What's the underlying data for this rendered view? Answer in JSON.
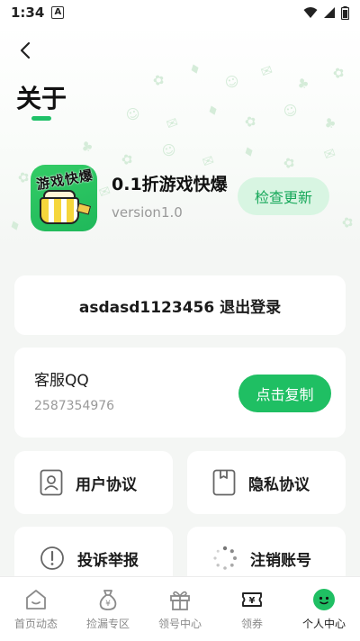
{
  "status_bar": {
    "time": "1:34",
    "notification_letter": "A"
  },
  "header": {
    "title": "关于",
    "back_label": "back"
  },
  "app": {
    "name": "0.1折游戏快爆",
    "version": "version1.0",
    "icon_text": "游戏快爆",
    "check_update_label": "检查更新"
  },
  "account": {
    "logout_label": "asdasd1123456 退出登录"
  },
  "support": {
    "title": "客服QQ",
    "number": "2587354976",
    "copy_label": "点击复制"
  },
  "links": [
    {
      "label": "用户协议",
      "icon": "document-person-icon"
    },
    {
      "label": "隐私协议",
      "icon": "folder-icon"
    },
    {
      "label": "投诉举报",
      "icon": "alert-circle-icon"
    },
    {
      "label": "注销账号",
      "icon": "loading-spinner-icon"
    }
  ],
  "tabs": [
    {
      "label": "首页动态",
      "icon": "home-icon",
      "active": false
    },
    {
      "label": "捡漏专区",
      "icon": "money-bag-icon",
      "active": false
    },
    {
      "label": "领号中心",
      "icon": "gift-icon",
      "active": false
    },
    {
      "label": "领券",
      "icon": "coupon-icon",
      "active": false
    },
    {
      "label": "个人中心",
      "icon": "smile-face-icon",
      "active": true
    }
  ],
  "colors": {
    "accent": "#1fbf63",
    "accent_light": "#d8f5e2",
    "muted_text": "#999999"
  }
}
